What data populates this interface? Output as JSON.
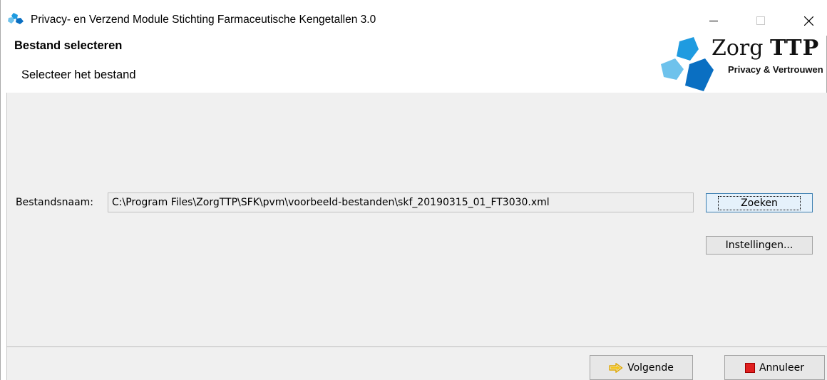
{
  "window": {
    "title": "Privacy- en Verzend Module Stichting Farmaceutische Kengetallen 3.0"
  },
  "header": {
    "title": "Bestand selecteren",
    "subtitle": "Selecteer het bestand",
    "logo": {
      "name_part1": "Zorg",
      "name_part2": "TTP",
      "tagline": "Privacy & Vertrouwen"
    }
  },
  "form": {
    "filename_label": "Bestandsnaam:",
    "filename_value": "C:\\Program Files\\ZorgTTP\\SFK\\pvm\\voorbeeld-bestanden\\skf_20190315_01_FT3030.xml",
    "search_label": "Zoeken",
    "settings_label": "Instellingen..."
  },
  "footer": {
    "next_label": "Volgende",
    "cancel_label": "Annuleer"
  },
  "colors": {
    "content_bg": "#f0f0f0",
    "logo_blue_dark": "#0a6fc2",
    "logo_blue_mid": "#1f9be0",
    "logo_blue_light": "#6ec2ec",
    "next_arrow": "#f5c518",
    "cancel_red": "#e02020"
  },
  "icons": [
    "app-icon",
    "minimize-icon",
    "maximize-icon",
    "close-icon",
    "arrow-right-icon",
    "stop-icon"
  ]
}
